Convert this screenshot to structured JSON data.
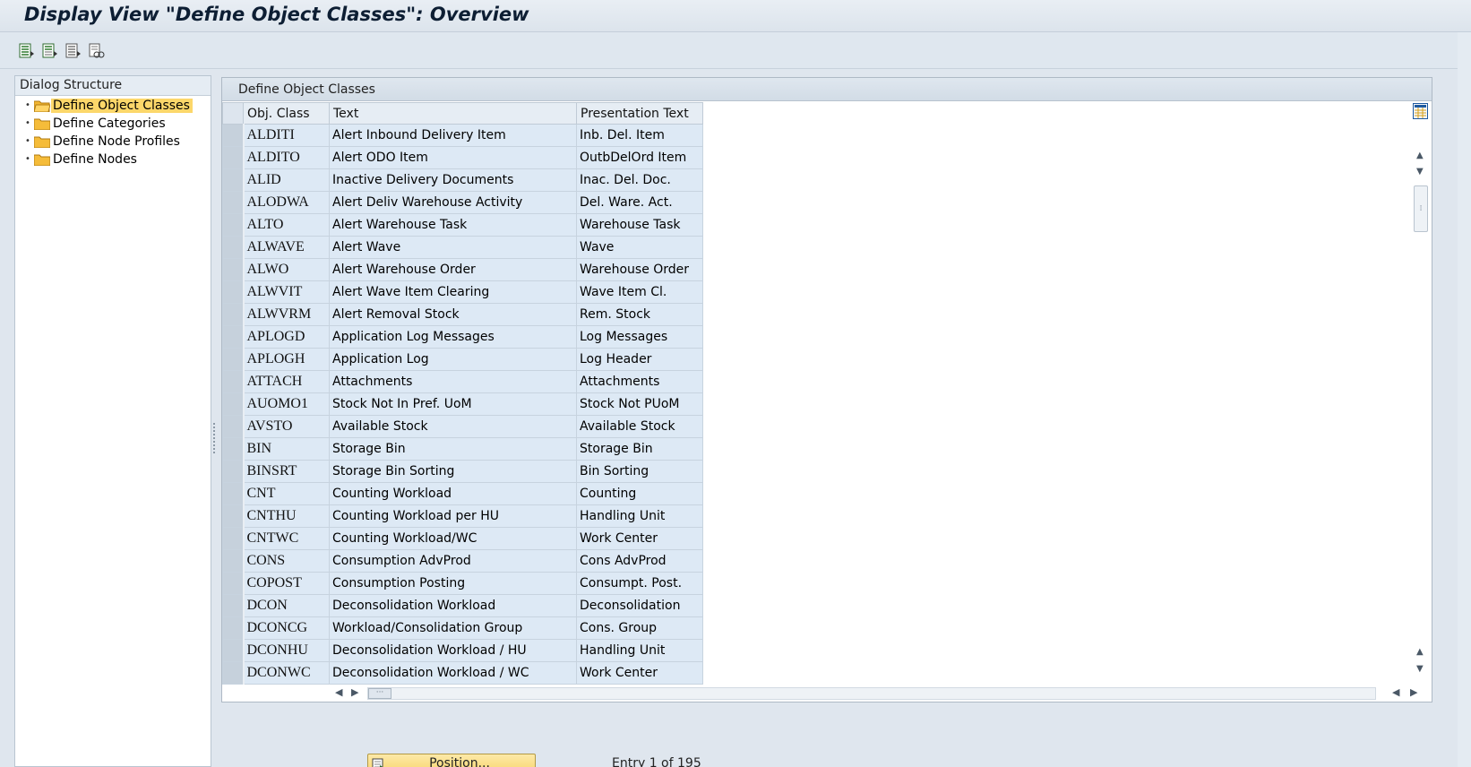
{
  "window": {
    "title": "Display View \"Define Object Classes\": Overview"
  },
  "toolbar": {
    "buttons": [
      "select-all-icon",
      "select-block-icon",
      "deselect-all-icon",
      "print-view-icon"
    ]
  },
  "dialog_structure": {
    "header": "Dialog Structure",
    "items": [
      {
        "label": "Define Object Classes",
        "selected": true
      },
      {
        "label": "Define Categories",
        "selected": false
      },
      {
        "label": "Define Node Profiles",
        "selected": false
      },
      {
        "label": "Define Nodes",
        "selected": false
      }
    ]
  },
  "table": {
    "title": "Define Object Classes",
    "columns": [
      "Obj. Class",
      "Text",
      "Presentation Text"
    ],
    "rows": [
      [
        "ALDITI",
        "Alert Inbound Delivery Item",
        "Inb. Del. Item"
      ],
      [
        "ALDITO",
        "Alert ODO Item",
        "OutbDelOrd Item"
      ],
      [
        "ALID",
        "Inactive Delivery Documents",
        "Inac. Del. Doc."
      ],
      [
        "ALODWA",
        "Alert Deliv Warehouse Activity",
        "Del. Ware. Act."
      ],
      [
        "ALTO",
        "Alert Warehouse Task",
        "Warehouse Task"
      ],
      [
        "ALWAVE",
        "Alert Wave",
        "Wave"
      ],
      [
        "ALWO",
        "Alert Warehouse Order",
        "Warehouse Order"
      ],
      [
        "ALWVIT",
        "Alert Wave Item Clearing",
        "Wave Item Cl."
      ],
      [
        "ALWVRM",
        "Alert Removal Stock",
        "Rem. Stock"
      ],
      [
        "APLOGD",
        "Application Log Messages",
        "Log Messages"
      ],
      [
        "APLOGH",
        "Application Log",
        "Log Header"
      ],
      [
        "ATTACH",
        "Attachments",
        "Attachments"
      ],
      [
        "AUOMO1",
        "Stock Not In Pref. UoM",
        "Stock Not PUoM"
      ],
      [
        "AVSTO",
        "Available Stock",
        "Available Stock"
      ],
      [
        "BIN",
        "Storage Bin",
        "Storage Bin"
      ],
      [
        "BINSRT",
        "Storage Bin Sorting",
        "Bin Sorting"
      ],
      [
        "CNT",
        "Counting Workload",
        "Counting"
      ],
      [
        "CNTHU",
        "Counting Workload per HU",
        "Handling Unit"
      ],
      [
        "CNTWC",
        "Counting Workload/WC",
        "Work Center"
      ],
      [
        "CONS",
        "Consumption AdvProd",
        "Cons AdvProd"
      ],
      [
        "COPOST",
        "Consumption Posting",
        "Consumpt. Post."
      ],
      [
        "DCON",
        "Deconsolidation Workload",
        "Deconsolidation"
      ],
      [
        "DCONCG",
        "Workload/Consolidation Group",
        "Cons. Group"
      ],
      [
        "DCONHU",
        "Deconsolidation Workload / HU",
        "Handling Unit"
      ],
      [
        "DCONWC",
        "Deconsolidation Workload / WC",
        "Work Center"
      ]
    ]
  },
  "footer": {
    "position_label": "Position...",
    "entry_text": "Entry 1 of 195"
  },
  "colors": {
    "selection": "#fcd76a",
    "row_bg": "#dde9f5",
    "header_bg": "#e6edf4",
    "button_bg": "#f8d56a"
  }
}
